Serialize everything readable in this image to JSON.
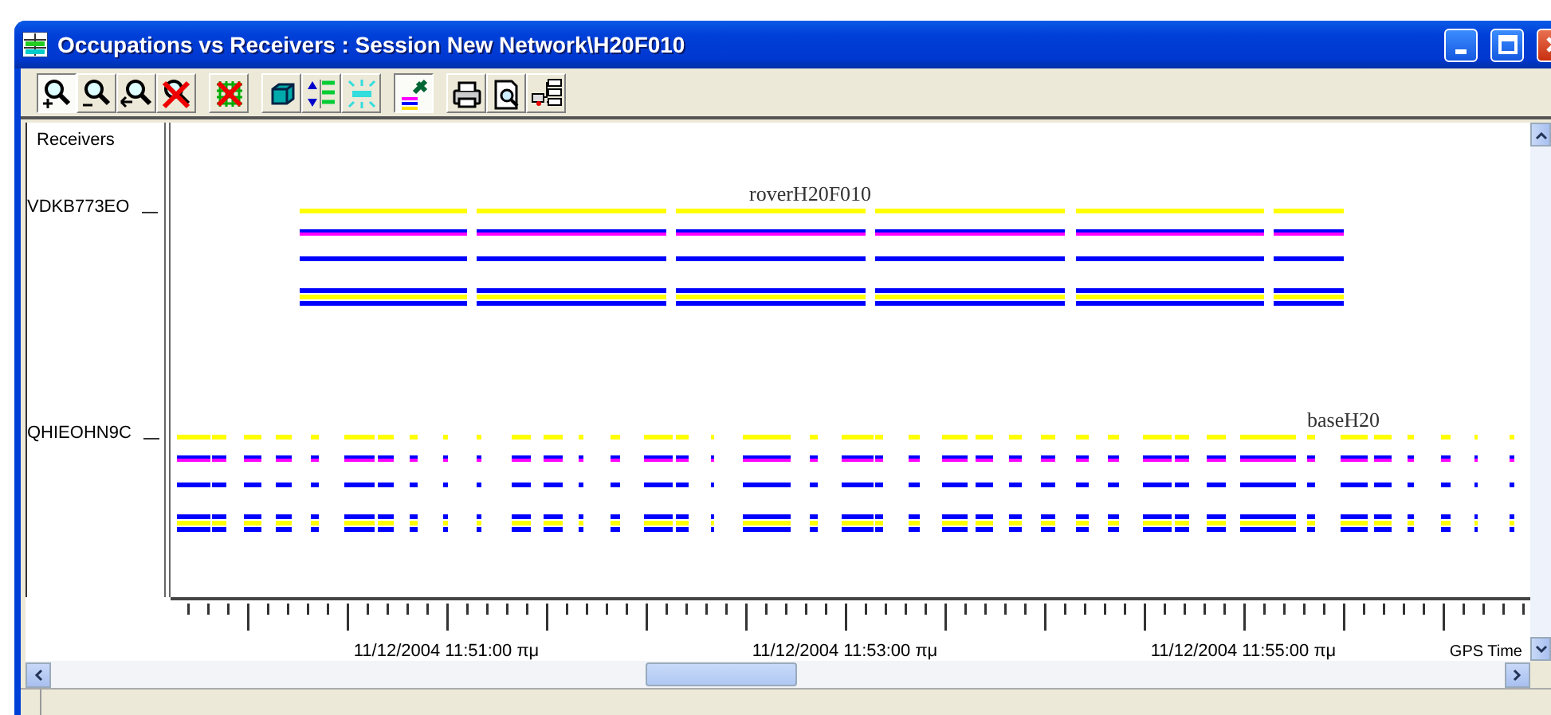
{
  "window": {
    "title": "Occupations vs Receivers : Session New Network\\H20F010"
  },
  "toolbar_groups": [
    {
      "buttons": [
        {
          "kind": "zoom-in",
          "pressed": true
        },
        {
          "kind": "zoom-out",
          "pressed": false
        },
        {
          "kind": "zoom-back",
          "pressed": false
        },
        {
          "kind": "zoom-cancel",
          "pressed": false
        }
      ]
    },
    {
      "buttons": [
        {
          "kind": "grid-cancel",
          "pressed": false
        }
      ]
    },
    {
      "buttons": [
        {
          "kind": "cube",
          "pressed": false
        },
        {
          "kind": "arrange",
          "pressed": false
        },
        {
          "kind": "spread",
          "pressed": false
        }
      ]
    },
    {
      "buttons": [
        {
          "kind": "satellite",
          "pressed": true
        }
      ]
    },
    {
      "buttons": [
        {
          "kind": "print",
          "pressed": false
        },
        {
          "kind": "preview",
          "pressed": false
        },
        {
          "kind": "tree",
          "pressed": false
        }
      ]
    }
  ],
  "receivers": {
    "header": "Receivers",
    "items": [
      {
        "label": "VDKB773EO",
        "session": "roverH20F010",
        "kind": "continuous"
      },
      {
        "label": "QHIEOHN9C",
        "session": "baseH20",
        "kind": "intermittent"
      }
    ]
  },
  "time_axis": {
    "labels": [
      "11/12/2004 11:51:00 πμ",
      "11/12/2004 11:53:00 πμ",
      "11/12/2004 11:55:00 πμ"
    ],
    "unit": "GPS Time"
  }
}
